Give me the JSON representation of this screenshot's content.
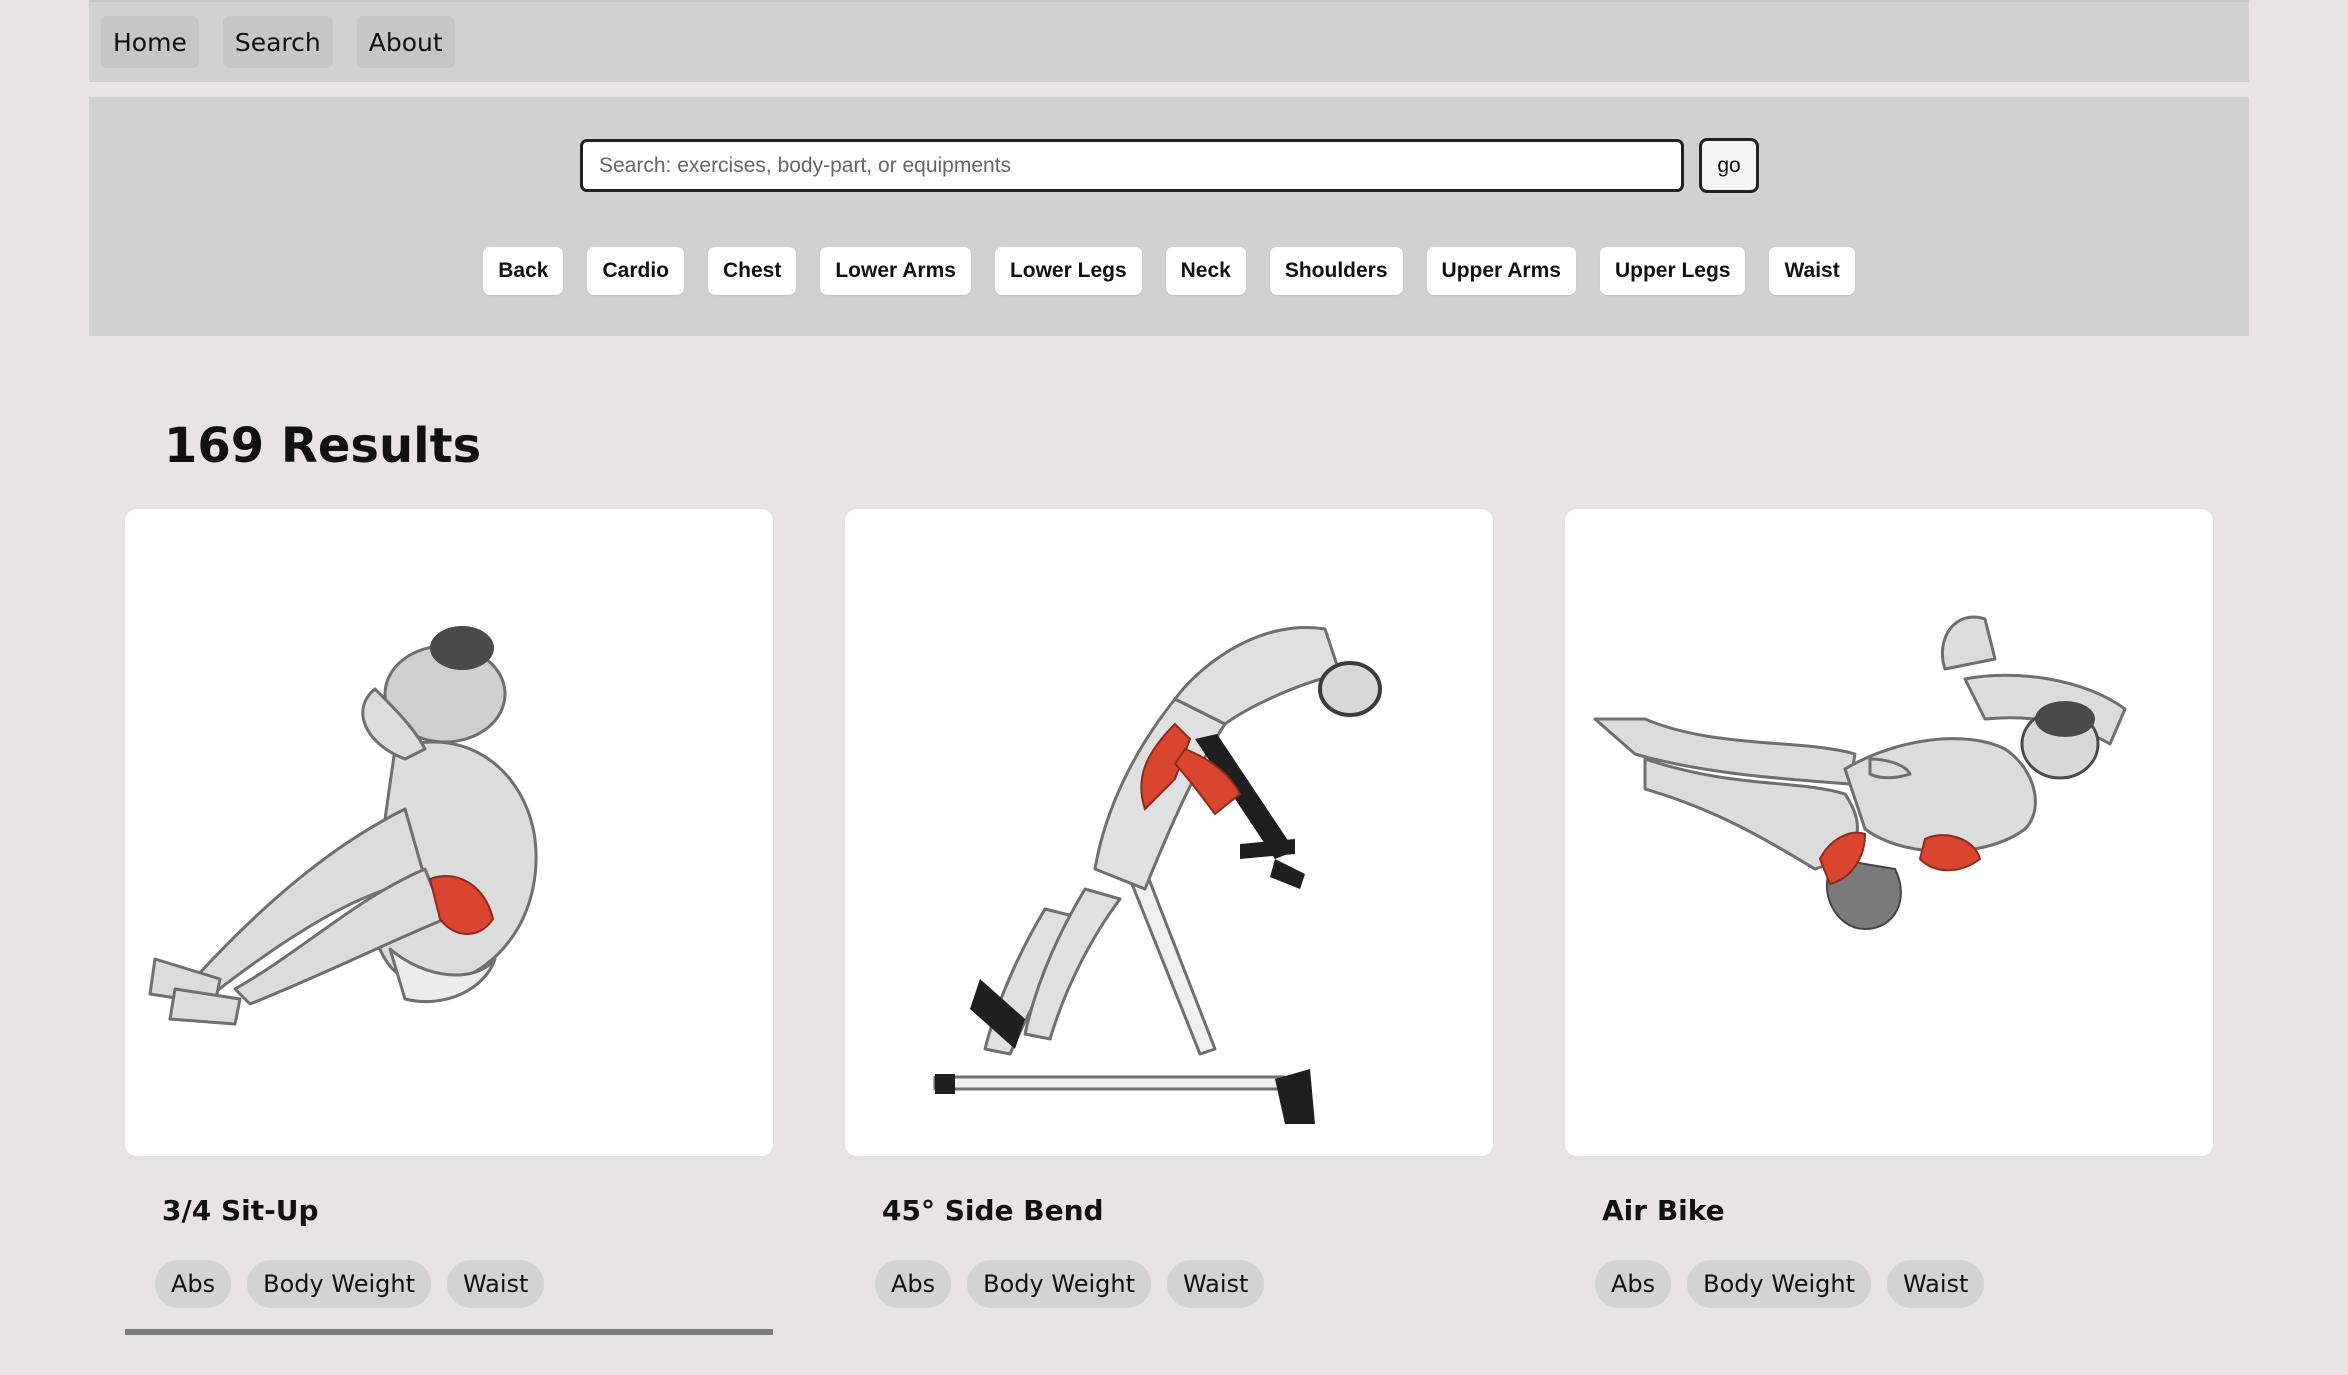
{
  "nav": {
    "items": [
      "Home",
      "Search",
      "About"
    ]
  },
  "search": {
    "placeholder": "Search: exercises, body-part, or equipments",
    "button_label": "go"
  },
  "body_parts": [
    "Back",
    "Cardio",
    "Chest",
    "Lower Arms",
    "Lower Legs",
    "Neck",
    "Shoulders",
    "Upper Arms",
    "Upper Legs",
    "Waist"
  ],
  "results": {
    "title": "169 Results",
    "cards": [
      {
        "name": "3/4 Sit-Up",
        "tags": [
          "Abs",
          "Body Weight",
          "Waist"
        ]
      },
      {
        "name": "45° Side Bend",
        "tags": [
          "Abs",
          "Body Weight",
          "Waist"
        ]
      },
      {
        "name": "Air Bike",
        "tags": [
          "Abs",
          "Body Weight",
          "Waist"
        ]
      }
    ]
  },
  "colors": {
    "highlight_muscle": "#d9452e",
    "muscle_shade": "#b9b9b9"
  }
}
